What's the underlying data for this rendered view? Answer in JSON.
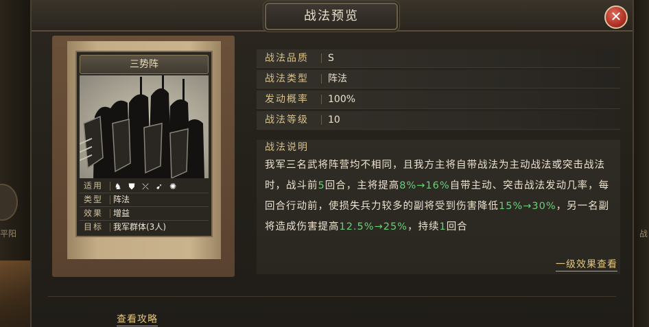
{
  "window": {
    "title": "战法预览"
  },
  "background": {
    "left_text": "平阳",
    "right_text": "战"
  },
  "card": {
    "name": "三势阵",
    "info": [
      {
        "key": "适用",
        "value": ""
      },
      {
        "key": "类型",
        "value": "阵法"
      },
      {
        "key": "效果",
        "value": "增益"
      },
      {
        "key": "目标",
        "value": "我军群体(3人)"
      }
    ],
    "unit_icons": [
      "cavalry-icon",
      "shield-icon",
      "bow-icon",
      "spear-icon",
      "chariot-icon"
    ]
  },
  "attributes": [
    {
      "key": "战法品质",
      "value": "S"
    },
    {
      "key": "战法类型",
      "value": "阵法"
    },
    {
      "key": "发动概率",
      "value": "100%"
    },
    {
      "key": "战法等级",
      "value": "10"
    }
  ],
  "description": {
    "title": "战法说明",
    "parts": [
      {
        "text": "我军三名武将阵营均不相同，且我方主将自带战法为主动战法或突击战法时，战斗前",
        "hl": false
      },
      {
        "text": "5",
        "hl": true
      },
      {
        "text": "回合，主将提高",
        "hl": false
      },
      {
        "text": "8%→16%",
        "hl": true
      },
      {
        "text": "自带主动、突击战法发动几率，每回合行动前，使损失兵力较多的副将受到伤害降低",
        "hl": false
      },
      {
        "text": "15%→30%",
        "hl": true
      },
      {
        "text": "，另一名副将造成伤害提高",
        "hl": false
      },
      {
        "text": "12.5%→25%",
        "hl": true
      },
      {
        "text": "，持续",
        "hl": false
      },
      {
        "text": "1",
        "hl": true
      },
      {
        "text": "回合",
        "hl": false
      }
    ]
  },
  "links": {
    "effect_view": "一级效果查看",
    "guide": "查看攻略"
  },
  "colors": {
    "highlight": "#6ad07a",
    "gold": "#d8c38a",
    "link": "#e0c680"
  }
}
